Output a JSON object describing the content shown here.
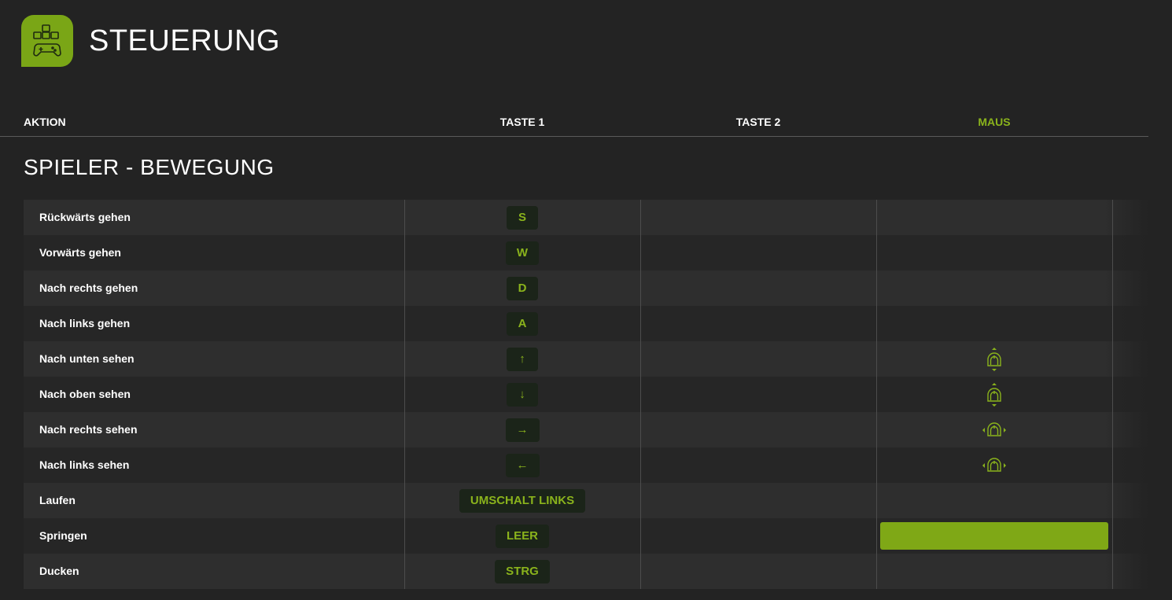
{
  "header": {
    "title": "STEUERUNG",
    "icon": "gamepad-keys-icon",
    "accent_color": "#7aa616"
  },
  "columns": {
    "action": "AKTION",
    "key1": "TASTE 1",
    "key2": "TASTE 2",
    "mouse": "MAUS",
    "mouse_color": "#8ab31c"
  },
  "section": {
    "title": "SPIELER - BEWEGUNG"
  },
  "rows": [
    {
      "label": "Rückwärts gehen",
      "key1": "S",
      "key2": "",
      "mouse": ""
    },
    {
      "label": "Vorwärts gehen",
      "key1": "W",
      "key2": "",
      "mouse": ""
    },
    {
      "label": "Nach rechts gehen",
      "key1": "D",
      "key2": "",
      "mouse": ""
    },
    {
      "label": "Nach links gehen",
      "key1": "A",
      "key2": "",
      "mouse": ""
    },
    {
      "label": "Nach unten sehen",
      "key1": "↑",
      "key2": "",
      "mouse": "mouse-vertical-icon"
    },
    {
      "label": "Nach oben sehen",
      "key1": "↓",
      "key2": "",
      "mouse": "mouse-vertical-icon"
    },
    {
      "label": "Nach rechts sehen",
      "key1": "→",
      "key2": "",
      "mouse": "mouse-horizontal-icon"
    },
    {
      "label": "Nach links sehen",
      "key1": "←",
      "key2": "",
      "mouse": "mouse-horizontal-icon"
    },
    {
      "label": "Laufen",
      "key1": "UMSCHALT LINKS",
      "key2": "",
      "mouse": ""
    },
    {
      "label": "Springen",
      "key1": "LEER",
      "key2": "",
      "mouse": "listening-highlight"
    },
    {
      "label": "Ducken",
      "key1": "STRG",
      "key2": "",
      "mouse": ""
    }
  ]
}
